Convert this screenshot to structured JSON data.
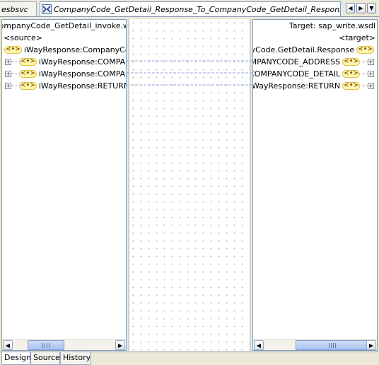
{
  "tabs": {
    "esbsvc_label": "esbsvc",
    "xsl_label": "CompanyCode_GetDetail_Response_To_CompanyCode_GetDetail_Response.xsl"
  },
  "source": {
    "header": "CompanyCode_GetDetail_invoke.wsdl?wsdl",
    "root_label": "<source>",
    "root_element": "iWayResponse:CompanyCode.GetDetail.Response",
    "children": [
      "iWayResponse:COMPANYCODE_ADDRESS",
      "iWayResponse:COMPANYCODE_DETAIL",
      "iWayResponse:RETURN"
    ]
  },
  "target": {
    "header": "Target: sap_write.wsdl",
    "root_label": "<target>",
    "root_element": "iWayResponse:CompanyCode.GetDetail.Response",
    "children": [
      "iWayResponse:COMPANYCODE_ADDRESS",
      "iWayResponse:COMPANYCODE_DETAIL",
      "iWayResponse:RETURN"
    ]
  },
  "bottom_tabs": {
    "design": "Design",
    "source": "Source",
    "history": "History"
  },
  "icons": {
    "element": "<•>",
    "expand": "+",
    "arrow_left": "◀",
    "arrow_right": "▶",
    "menu": "▼"
  },
  "colors": {
    "chrome": "#ece9d8",
    "panel_border": "#7f9db9",
    "connector": "#9f9fe0"
  }
}
